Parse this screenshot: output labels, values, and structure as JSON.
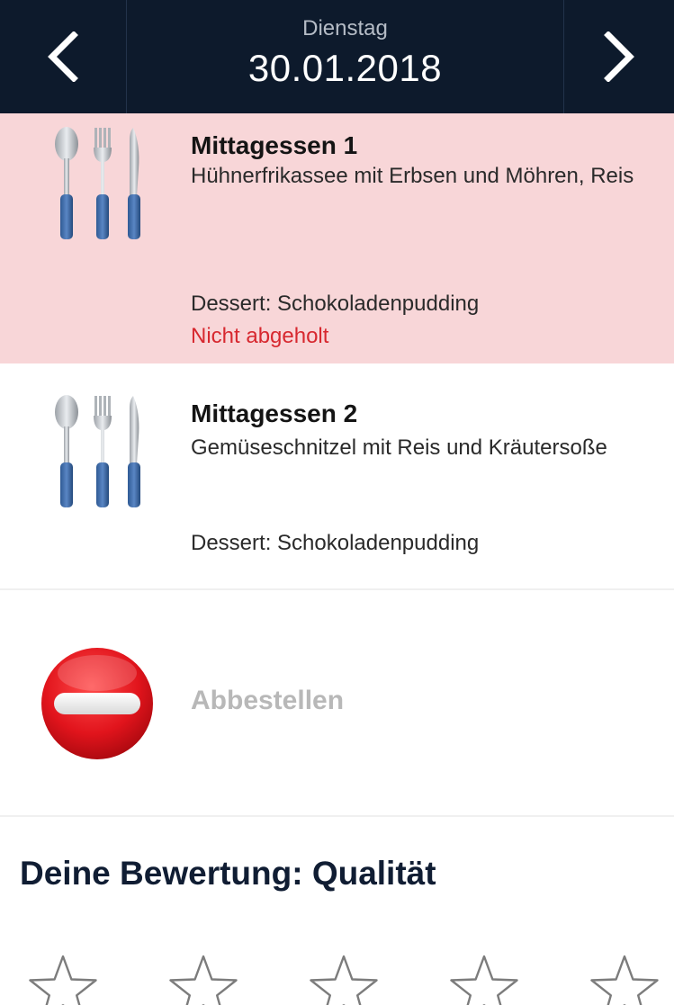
{
  "header": {
    "weekday": "Dienstag",
    "date": "30.01.2018",
    "prev_icon": "chevron-left-icon",
    "next_icon": "chevron-right-icon",
    "background": "#0d1a2c"
  },
  "meals": [
    {
      "title": "Mittagessen 1",
      "description": "Hühnerfrikassee mit Erbsen und Möhren, Reis",
      "dessert": "Dessert: Schokoladenpudding",
      "status": "Nicht abgeholt",
      "icon": "cutlery-icon",
      "background": "#f8d6d8",
      "status_color": "#d7282f"
    },
    {
      "title": "Mittagessen 2",
      "description": "Gemüseschnitzel mit Reis und Kräutersoße",
      "dessert": "Dessert: Schokoladenpudding",
      "icon": "cutlery-icon",
      "background": "#ffffff"
    }
  ],
  "cancel": {
    "label": "Abbestellen",
    "icon": "no-entry-icon",
    "icon_color": "#e1141c"
  },
  "rating": {
    "title": "Deine Bewertung: Qualität",
    "max_stars": 5,
    "value": 0,
    "star_icon": "star-outline-icon"
  }
}
